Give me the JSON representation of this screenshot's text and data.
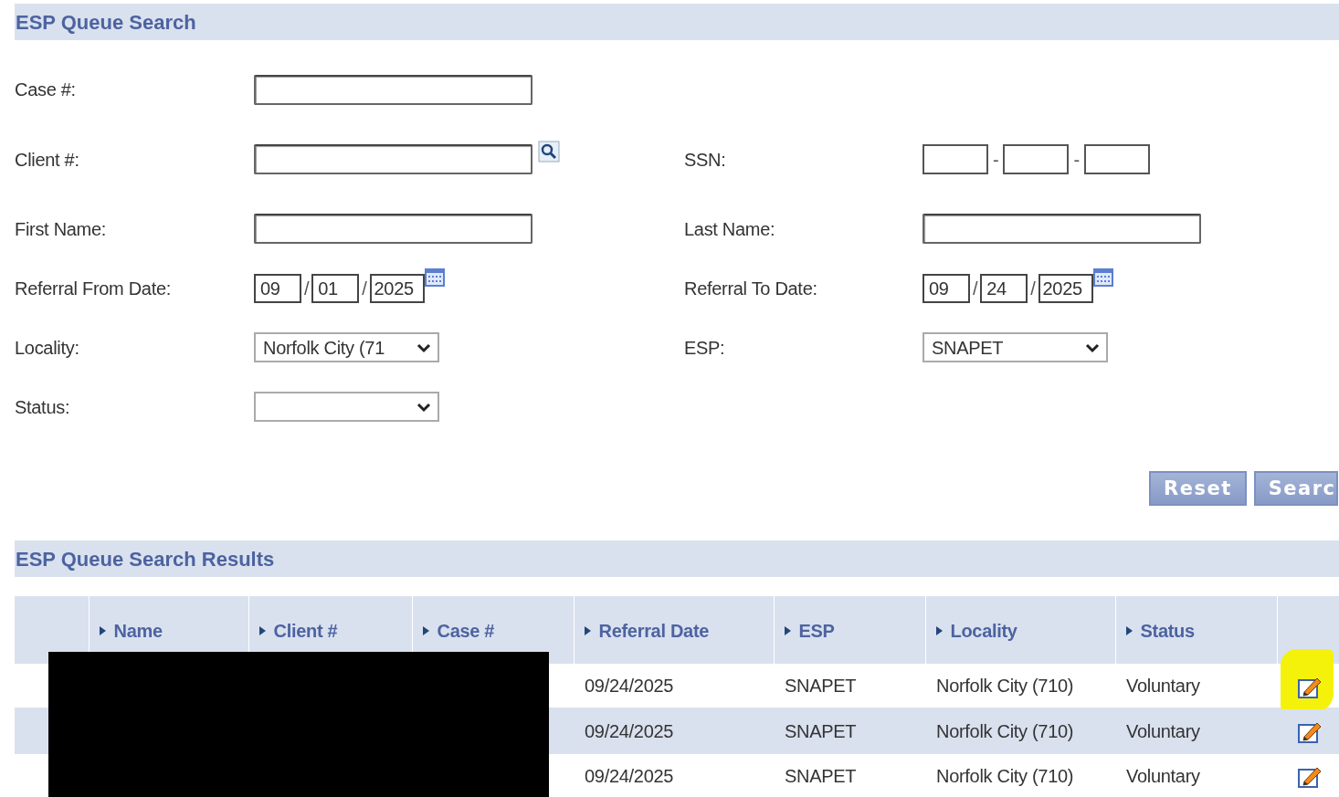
{
  "search_panel": {
    "title": "ESP Queue Search",
    "rows": [
      [
        {
          "kind": "text",
          "label": "Case #:"
        },
        null
      ],
      [
        {
          "kind": "lookup",
          "label": "Client #:"
        },
        {
          "kind": "ssn",
          "label": "SSN:",
          "separator": "-"
        }
      ],
      [
        {
          "kind": "text",
          "label": "First Name:"
        },
        {
          "kind": "text",
          "label": "Last Name:"
        }
      ],
      [
        {
          "kind": "date",
          "label": "Referral From Date:",
          "month": "09",
          "day": "01",
          "year": "2025",
          "separator": "/"
        },
        {
          "kind": "date",
          "label": "Referral To Date:",
          "month": "09",
          "day": "24",
          "year": "2025",
          "separator": "/"
        }
      ],
      [
        {
          "kind": "select",
          "label": "Locality:",
          "value": "Norfolk City (71"
        },
        {
          "kind": "select",
          "label": "ESP:",
          "value": "SNAPET"
        }
      ],
      [
        {
          "kind": "select",
          "label": "Status:"
        },
        null
      ]
    ],
    "buttons": [
      "Reset",
      "Searc"
    ]
  },
  "results": {
    "title": "ESP Queue Search Results",
    "columns": [
      "Name",
      "Client #",
      "Case #",
      "Referral Date",
      "ESP",
      "Locality",
      "Status"
    ],
    "rows": [
      {
        "referral_date": "09/24/2025",
        "esp": "SNAPET",
        "locality": "Norfolk City (710)",
        "status": "Voluntary",
        "highlighted": true
      },
      {
        "referral_date": "09/24/2025",
        "esp": "SNAPET",
        "locality": "Norfolk City (710)",
        "status": "Voluntary",
        "highlighted": false
      },
      {
        "referral_date": "09/24/2025",
        "esp": "SNAPET",
        "locality": "Norfolk City (710)",
        "status": "Voluntary",
        "highlighted": false
      }
    ],
    "redacted": true
  }
}
